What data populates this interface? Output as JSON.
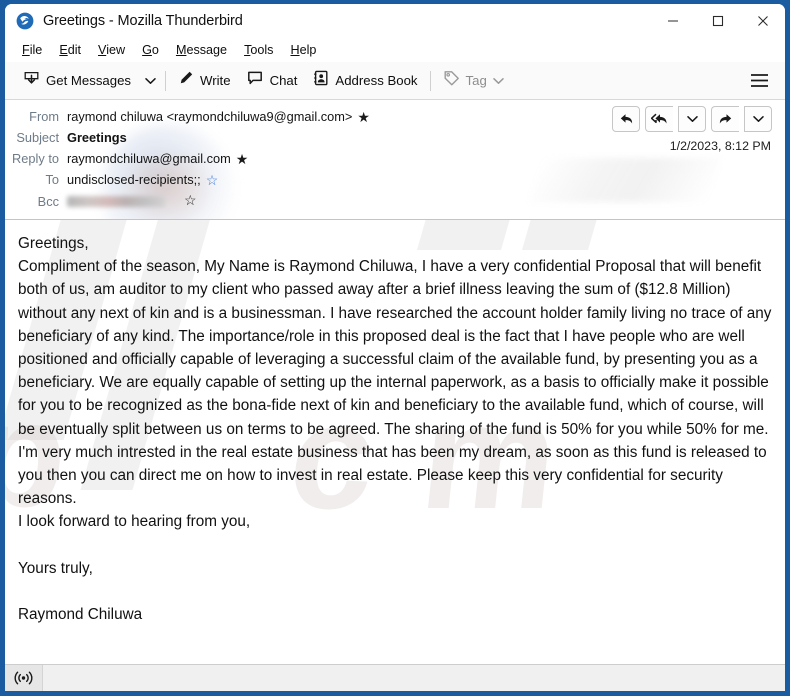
{
  "window": {
    "title": "Greetings - Mozilla Thunderbird",
    "app_icon": "thunderbird-icon",
    "controls": {
      "minimize": "minimize-icon",
      "maximize": "maximize-icon",
      "close": "close-icon"
    }
  },
  "menu": {
    "items": [
      {
        "label": "File",
        "accel": "F"
      },
      {
        "label": "Edit",
        "accel": "E"
      },
      {
        "label": "View",
        "accel": "V"
      },
      {
        "label": "Go",
        "accel": "G"
      },
      {
        "label": "Message",
        "accel": "M"
      },
      {
        "label": "Tools",
        "accel": "T"
      },
      {
        "label": "Help",
        "accel": "H"
      }
    ]
  },
  "toolbar": {
    "get_messages_label": "Get Messages",
    "write_label": "Write",
    "chat_label": "Chat",
    "address_book_label": "Address Book",
    "tag_label": "Tag",
    "app_menu_icon": "hamburger-icon"
  },
  "header": {
    "from_label": "From",
    "from_value": "raymond chiluwa <raymondchiluwa9@gmail.com>",
    "subject_label": "Subject",
    "subject_value": "Greetings",
    "reply_to_label": "Reply to",
    "reply_to_value": "raymondchiluwa@gmail.com",
    "to_label": "To",
    "to_value": "undisclosed-recipients;;",
    "bcc_label": "Bcc",
    "bcc_value": "",
    "date": "1/2/2023, 8:12 PM",
    "actions": {
      "reply": "reply-icon",
      "reply_all": "reply-all-icon",
      "reply_all_more": "chevron-down-icon",
      "forward": "forward-icon",
      "forward_more": "chevron-down-icon"
    }
  },
  "body": {
    "watermark_text": "pcrisk.com",
    "lines": [
      "Greetings,",
      "Compliment of the season, My Name is Raymond Chiluwa, I have a very confidential Proposal that will benefit both of us, am auditor to my client who passed away after a brief illness leaving the sum of ($12.8 Million) without any next of kin and is a businessman. I have researched the account holder family living no trace of any beneficiary of any kind. The importance/role in this proposed deal is the fact that I have people who are well positioned and officially capable of leveraging a successful claim of the available fund, by presenting you as a beneficiary. We are equally capable of setting up the internal paperwork, as a basis to officially make it possible for you to be recognized as the bona-fide next of kin and beneficiary to the available fund, which of course, will be eventually split between us on terms to be agreed. The sharing of the fund is 50% for you while 50% for me. I'm very much intrested in the real estate business that has been my dream, as soon as this fund is released to you then you can direct me on how to invest in real estate. Please keep this very confidential for security reasons.",
      "I look forward to hearing from you,",
      "",
      "Yours truly,",
      "",
      "Raymond Chiluwa"
    ]
  },
  "status": {
    "icon": "broadcast-icon",
    "text": ""
  },
  "colors": {
    "window_border": "#1b5ba0",
    "toolbar_bg": "#fafafa",
    "header_label": "#6e7b88",
    "star_blue": "#3a7ad9",
    "body_text": "#111111"
  }
}
